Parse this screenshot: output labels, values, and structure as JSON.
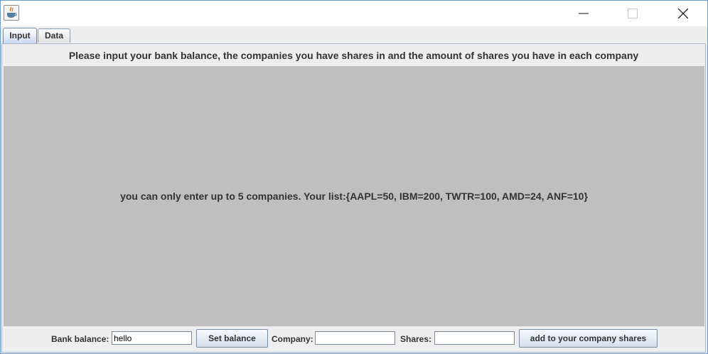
{
  "window": {
    "icons": {
      "app": "java-cup-icon",
      "minimize": "minimize-icon",
      "maximize": "maximize-icon",
      "close": "close-icon"
    }
  },
  "tabs": [
    {
      "label": "Input",
      "selected": true
    },
    {
      "label": "Data",
      "selected": false
    }
  ],
  "input_tab": {
    "header": "Please input your bank balance, the companies you have shares in and the amount of shares you have in each company",
    "status": "you can only enter up to 5 companies. Your list:{AAPL=50, IBM=200, TWTR=100, AMD=24, ANF=10}",
    "bank_balance_label": "Bank balance:",
    "bank_balance_value": "hello",
    "set_balance_button": "Set balance",
    "company_label": "Company:",
    "company_value": "",
    "shares_label": "Shares:",
    "shares_value": "",
    "add_button": "add to your company shares"
  },
  "colors": {
    "content_background": "#bfbfbf",
    "selected_tab_gradient_end": "#c9daf0"
  }
}
